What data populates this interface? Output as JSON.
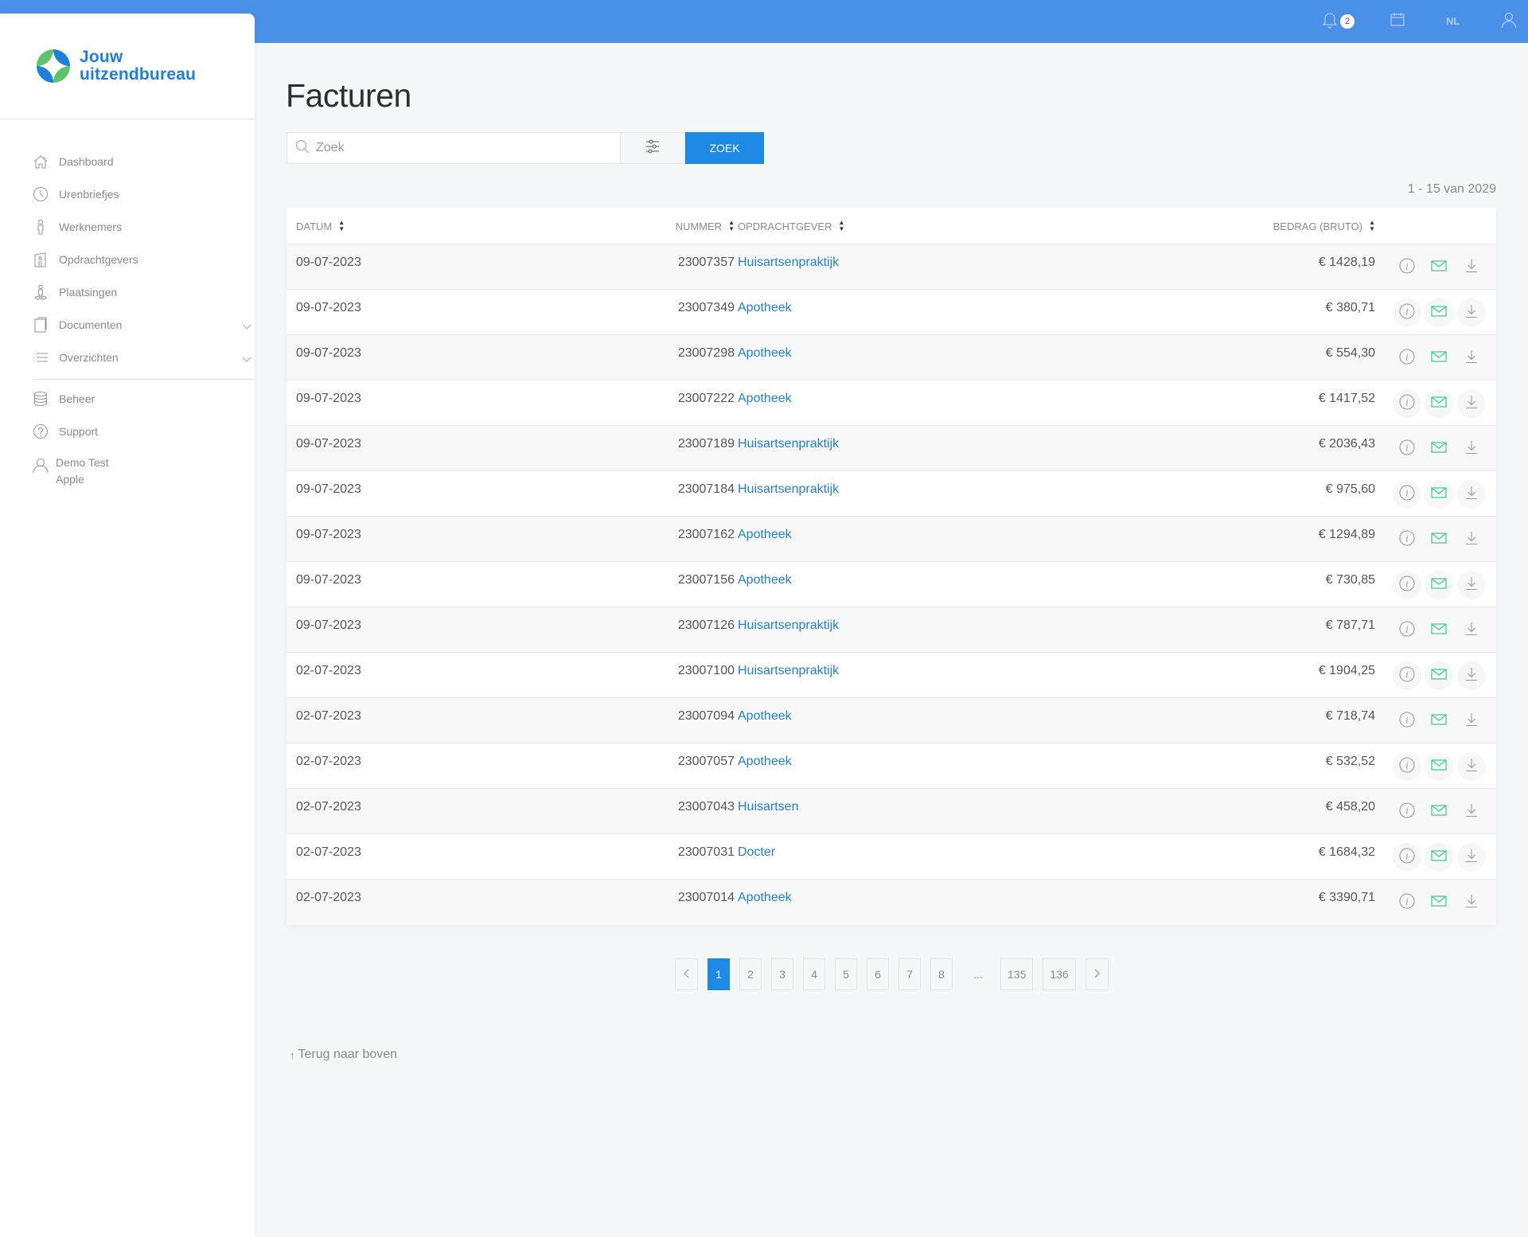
{
  "topbar": {
    "notification_count": "2",
    "language": "NL"
  },
  "brand": {
    "line1": "Jouw",
    "line2": "uitzendbureau",
    "colors": {
      "blue": "#1d7fde",
      "green": "#5cc46a"
    }
  },
  "sidebar": {
    "items": [
      {
        "label": "Dashboard",
        "icon": "home-icon"
      },
      {
        "label": "Urenbriefjes",
        "icon": "clock-icon"
      },
      {
        "label": "Werknemers",
        "icon": "person-icon"
      },
      {
        "label": "Opdrachtgevers",
        "icon": "building-icon"
      },
      {
        "label": "Plaatsingen",
        "icon": "placement-icon"
      },
      {
        "label": "Documenten",
        "icon": "document-icon",
        "expandable": true
      },
      {
        "label": "Overzichten",
        "icon": "list-icon",
        "expandable": true
      }
    ],
    "secondary": [
      {
        "label": "Beheer",
        "icon": "database-icon"
      },
      {
        "label": "Support",
        "icon": "help-icon"
      }
    ],
    "user": {
      "line1": "Demo Test",
      "line2": "Apple"
    }
  },
  "page": {
    "title": "Facturen",
    "search": {
      "placeholder": "Zoek",
      "value": ""
    },
    "search_button": "ZOEK",
    "result_count": "1 - 15 van 2029"
  },
  "table": {
    "columns": [
      "DATUM",
      "NUMMER",
      "OPDRACHTGEVER",
      "BEDRAG (BRUTO)"
    ],
    "rows": [
      {
        "date": "09-07-2023",
        "number": "23007357",
        "client": "Huisartsenpraktijk",
        "amount": "€ 1428,19"
      },
      {
        "date": "09-07-2023",
        "number": "23007349",
        "client": "Apotheek",
        "amount": "€ 380,71"
      },
      {
        "date": "09-07-2023",
        "number": "23007298",
        "client": "Apotheek",
        "amount": "€ 554,30"
      },
      {
        "date": "09-07-2023",
        "number": "23007222",
        "client": "Apotheek",
        "amount": "€ 1417,52"
      },
      {
        "date": "09-07-2023",
        "number": "23007189",
        "client": "Huisartsenpraktijk",
        "amount": "€ 2036,43"
      },
      {
        "date": "09-07-2023",
        "number": "23007184",
        "client": "Huisartsenpraktijk",
        "amount": "€ 975,60"
      },
      {
        "date": "09-07-2023",
        "number": "23007162",
        "client": "Apotheek",
        "amount": "€ 1294,89"
      },
      {
        "date": "09-07-2023",
        "number": "23007156",
        "client": "Apotheek",
        "amount": "€ 730,85"
      },
      {
        "date": "09-07-2023",
        "number": "23007126",
        "client": "Huisartsenpraktijk",
        "amount": "€ 787,71"
      },
      {
        "date": "02-07-2023",
        "number": "23007100",
        "client": "Huisartsenpraktijk",
        "amount": "€ 1904,25"
      },
      {
        "date": "02-07-2023",
        "number": "23007094",
        "client": "Apotheek",
        "amount": "€ 718,74"
      },
      {
        "date": "02-07-2023",
        "number": "23007057",
        "client": "Apotheek",
        "amount": "€ 532,52"
      },
      {
        "date": "02-07-2023",
        "number": "23007043",
        "client": "Huisartsen",
        "amount": "€ 458,20"
      },
      {
        "date": "02-07-2023",
        "number": "23007031",
        "client": "Docter",
        "amount": "€ 1684,32"
      },
      {
        "date": "02-07-2023",
        "number": "23007014",
        "client": "Apotheek",
        "amount": "€ 3390,71"
      }
    ],
    "row_actions": [
      "info-icon",
      "mail-icon",
      "download-icon"
    ]
  },
  "pagination": {
    "pages": [
      "1",
      "2",
      "3",
      "4",
      "5",
      "6",
      "7",
      "8",
      "...",
      "135",
      "136"
    ],
    "current": "1"
  },
  "footer": {
    "back_to_top": "Terug naar boven"
  },
  "colors": {
    "header": "#4a8fe8",
    "accent": "#1e88e5",
    "link": "#1d7fde",
    "mail": "#3ecf9a"
  }
}
